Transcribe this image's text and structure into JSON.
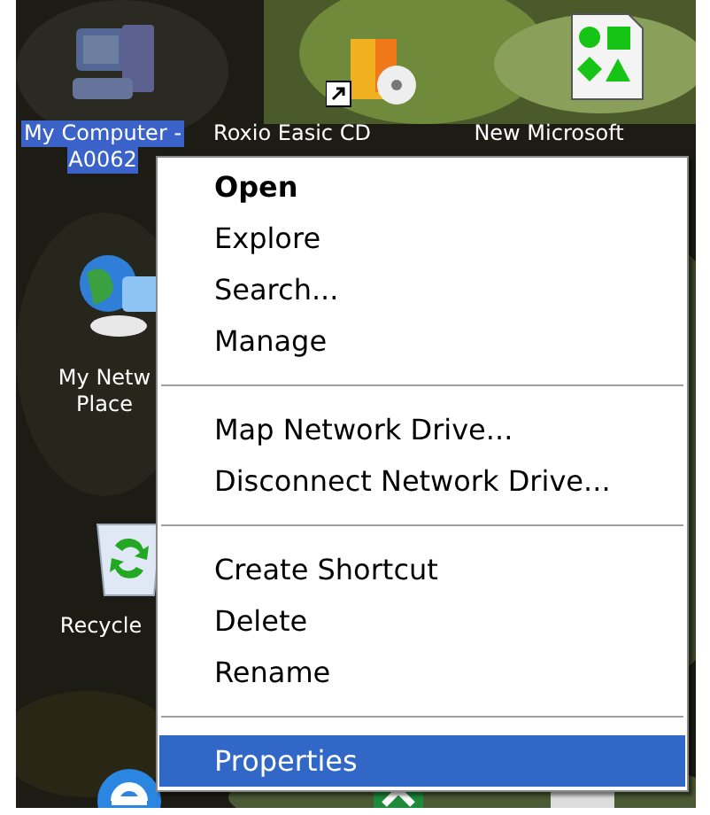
{
  "desktop_icons": [
    {
      "kind": "computer",
      "selected": true,
      "lines": [
        "My Computer -",
        "A0062"
      ]
    },
    {
      "kind": "cd-shortcut",
      "selected": false,
      "lines": [
        "Roxio Easic CD"
      ]
    },
    {
      "kind": "shapes-document",
      "selected": false,
      "lines": [
        "New Microsoft"
      ]
    },
    {
      "kind": "network",
      "selected": false,
      "lines": [
        "My Netw",
        "Place"
      ]
    },
    {
      "kind": "recycle",
      "selected": false,
      "lines": [
        "Recycle"
      ]
    },
    {
      "kind": "browser"
    },
    {
      "kind": "spreadsheet"
    },
    {
      "kind": "printer"
    }
  ],
  "context_menu": [
    {
      "kind": "item",
      "label": "Open",
      "default": true,
      "selected": false
    },
    {
      "kind": "item",
      "label": "Explore",
      "default": false,
      "selected": false
    },
    {
      "kind": "item",
      "label": "Search...",
      "default": false,
      "selected": false
    },
    {
      "kind": "item",
      "label": "Manage",
      "default": false,
      "selected": false
    },
    {
      "kind": "separator"
    },
    {
      "kind": "item",
      "label": "Map Network Drive...",
      "default": false,
      "selected": false
    },
    {
      "kind": "item",
      "label": "Disconnect Network Drive...",
      "default": false,
      "selected": false
    },
    {
      "kind": "separator"
    },
    {
      "kind": "item",
      "label": "Create Shortcut",
      "default": false,
      "selected": false
    },
    {
      "kind": "item",
      "label": "Delete",
      "default": false,
      "selected": false
    },
    {
      "kind": "item",
      "label": "Rename",
      "default": false,
      "selected": false
    },
    {
      "kind": "separator"
    },
    {
      "kind": "item",
      "label": "Properties",
      "default": false,
      "selected": true
    }
  ]
}
